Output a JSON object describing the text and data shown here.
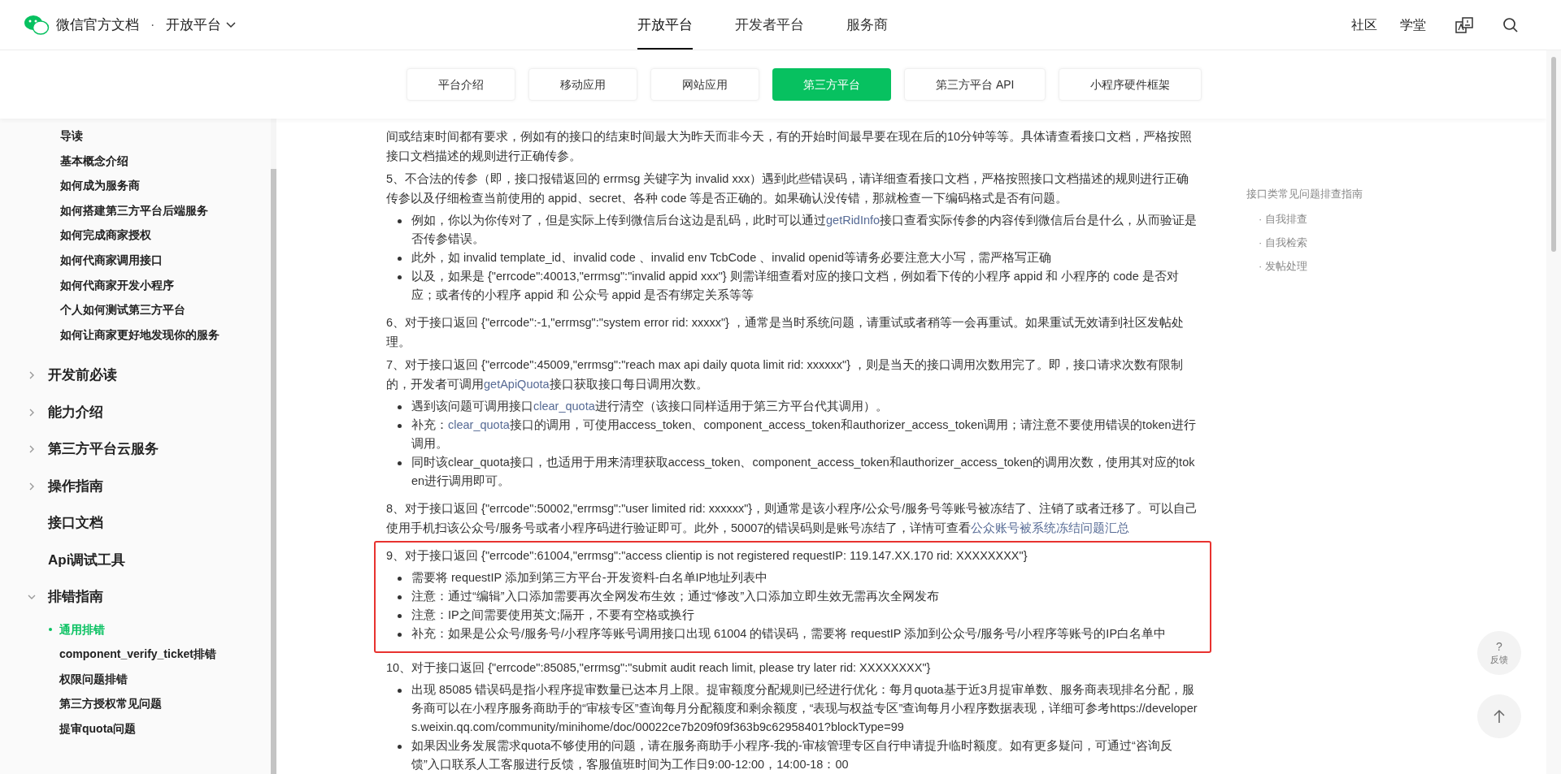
{
  "header": {
    "brand": "微信官方文档",
    "separator": "·",
    "platform": "开放平台",
    "nav": [
      {
        "label": "开放平台",
        "selected": true
      },
      {
        "label": "开发者平台",
        "selected": false
      },
      {
        "label": "服务商",
        "selected": false
      }
    ],
    "links": [
      "社区",
      "学堂"
    ]
  },
  "subnav": [
    {
      "label": "平台介绍",
      "selected": false
    },
    {
      "label": "移动应用",
      "selected": false
    },
    {
      "label": "网站应用",
      "selected": false
    },
    {
      "label": "第三方平台",
      "selected": true
    },
    {
      "label": "第三方平台 API",
      "selected": false
    },
    {
      "label": "小程序硬件框架",
      "selected": false
    }
  ],
  "sidebar": {
    "links": [
      {
        "label": "导读",
        "selected": false
      },
      {
        "label": "基本概念介绍",
        "selected": false
      },
      {
        "label": "如何成为服务商",
        "selected": false
      },
      {
        "label": "如何搭建第三方平台后端服务",
        "selected": false
      },
      {
        "label": "如何完成商家授权",
        "selected": false
      },
      {
        "label": "如何代商家调用接口",
        "selected": false
      },
      {
        "label": "如何代商家开发小程序",
        "selected": false
      },
      {
        "label": "个人如何测试第三方平台",
        "selected": false
      },
      {
        "label": "如何让商家更好地发现你的服务",
        "selected": false
      }
    ],
    "sections": [
      {
        "label": "开发前必读",
        "kind": "group",
        "expanded": false
      },
      {
        "label": "能力介绍",
        "kind": "group",
        "expanded": false
      },
      {
        "label": "第三方平台云服务",
        "kind": "group",
        "expanded": false
      },
      {
        "label": "操作指南",
        "kind": "group",
        "expanded": false
      },
      {
        "label": "接口文档",
        "kind": "link"
      },
      {
        "label": "Api调试工具",
        "kind": "link"
      },
      {
        "label": "排错指南",
        "kind": "group",
        "expanded": true,
        "children": [
          {
            "label": "通用排错",
            "selected": true
          },
          {
            "label": "component_verify_ticket排错",
            "selected": false
          },
          {
            "label": "权限问题排错",
            "selected": false
          },
          {
            "label": "第三方授权常见问题",
            "selected": false
          },
          {
            "label": "提审quota问题",
            "selected": false
          }
        ]
      }
    ]
  },
  "content": [
    {
      "kind": "paragraph",
      "parts": [
        {
          "kind": "text",
          "text": "间或结束时间都有要求，例如有的接口的结束时间最大为昨天而非今天，有的开始时间最早要在现在后的10分钟等等。具体请查看接口文档，严格按照接口文档描述的规则进行正确传参。"
        }
      ]
    },
    {
      "kind": "paragraph",
      "parts": [
        {
          "kind": "text",
          "text": "5、不合法的传参（即，接口报错返回的 errmsg 关键字为 invalid xxx）遇到此些错误码，请详细查看接口文档，严格按照接口文档描述的规则进行正确传参以及仔细检查当前使用的 appid、secret、各种 code 等是否正确的。如果确认没传错，那就检查一下编码格式是否有问题。"
        }
      ]
    },
    {
      "kind": "list",
      "items": [
        [
          {
            "kind": "text",
            "text": "例如，你以为你传对了，但是实际上传到微信后台这边是乱码，此时可以通过"
          },
          {
            "kind": "link",
            "text": "getRidInfo"
          },
          {
            "kind": "text",
            "text": "接口查看实际传参的内容传到微信后台是什么，从而验证是否传参错误。"
          }
        ],
        [
          {
            "kind": "text",
            "text": "此外，如 invalid template_id、invalid code 、invalid env TcbCode 、invalid openid等请务必要注意大小写，需严格写正确"
          }
        ],
        [
          {
            "kind": "text",
            "text": "以及，如果是 {\"errcode\":40013,\"errmsg\":\"invalid appid xxx\"} 则需详细查看对应的接口文档，例如看下传的小程序 appid 和 小程序的 code 是否对应；或者传的小程序 appid 和 公众号 appid 是否有绑定关系等等"
          }
        ]
      ]
    },
    {
      "kind": "paragraph",
      "parts": [
        {
          "kind": "text",
          "text": "6、对于接口返回 {\"errcode\":-1,\"errmsg\":\"system error rid: xxxxx\"} ，通常是当时系统问题，请重试或者稍等一会再重试。如果重试无效请到社区发帖处理。"
        }
      ]
    },
    {
      "kind": "paragraph",
      "parts": [
        {
          "kind": "text",
          "text": "7、对于接口返回 {\"errcode\":45009,\"errmsg\":\"reach max api daily quota limit rid: xxxxxx\"} ，则是当天的接口调用次数用完了。即，接口请求次数有限制的，开发者可调用"
        },
        {
          "kind": "link",
          "text": "getApiQuota"
        },
        {
          "kind": "text",
          "text": "接口获取接口每日调用次数。"
        }
      ]
    },
    {
      "kind": "list",
      "items": [
        [
          {
            "kind": "text",
            "text": "遇到该问题可调用接口"
          },
          {
            "kind": "link",
            "text": "clear_quota"
          },
          {
            "kind": "text",
            "text": "进行清空（该接口同样适用于第三方平台代其调用）。"
          }
        ],
        [
          {
            "kind": "text",
            "text": "补充："
          },
          {
            "kind": "link",
            "text": "clear_quota"
          },
          {
            "kind": "text",
            "text": "接口的调用，可使用access_token、component_access_token和authorizer_access_token调用；请注意不要使用错误的token进行调用。"
          }
        ],
        [
          {
            "kind": "text",
            "text": "同时该clear_quota接口，也适用于用来清理获取access_token、component_access_token和authorizer_access_token的调用次数，使用其对应的token进行调用即可。"
          }
        ]
      ]
    },
    {
      "kind": "paragraph",
      "parts": [
        {
          "kind": "text",
          "text": "8、对于接口返回 {\"errcode\":50002,\"errmsg\":\"user limited rid: xxxxxx\"}，则通常是该小程序/公众号/服务号等账号被冻结了、注销了或者迁移了。可以自己使用手机扫该公众号/服务号或者小程序码进行验证即可。此外，50007的错误码则是账号冻结了，详情可查看"
        },
        {
          "kind": "link",
          "text": "公众账号被系统冻结问题汇总"
        }
      ]
    },
    {
      "kind": "boxed",
      "blocks": [
        {
          "kind": "paragraph",
          "parts": [
            {
              "kind": "text",
              "text": "9、对于接口返回 {\"errcode\":61004,\"errmsg\":\"access clientip is not registered requestIP: 119.147.XX.170 rid: XXXXXXXX\"}"
            }
          ]
        },
        {
          "kind": "list",
          "items": [
            [
              {
                "kind": "text",
                "text": "需要将 requestIP 添加到第三方平台-开发资料-白名单IP地址列表中"
              }
            ],
            [
              {
                "kind": "text",
                "text": "注意：通过“编辑”入口添加需要再次全网发布生效；通过“修改”入口添加立即生效无需再次全网发布"
              }
            ],
            [
              {
                "kind": "text",
                "text": "注意：IP之间需要使用英文;隔开，不要有空格或换行"
              }
            ],
            [
              {
                "kind": "text",
                "text": "补充：如果是公众号/服务号/小程序等账号调用接口出现 61004 的错误码，需要将 requestIP 添加到公众号/服务号/小程序等账号的IP白名单中"
              }
            ]
          ]
        }
      ]
    },
    {
      "kind": "paragraph",
      "parts": [
        {
          "kind": "text",
          "text": "10、对于接口返回 {\"errcode\":85085,\"errmsg\":\"submit audit reach limit, please try later rid: XXXXXXXX\"}"
        }
      ]
    },
    {
      "kind": "list",
      "items": [
        [
          {
            "kind": "text",
            "text": "出现 85085 错误码是指小程序提审数量已达本月上限。提审额度分配规则已经进行优化：每月quota基于近3月提审单数、服务商表现排名分配，服务商可以在小程序服务商助手的“审核专区”查询每月分配额度和剩余额度，“表现与权益专区”查询每月小程序数据表现，详细可参考https://developers.weixin.qq.com/community/minihome/doc/00022ce7b209f09f363b9c62958401?blockType=99"
          }
        ],
        [
          {
            "kind": "text",
            "text": "如果因业务发展需求quota不够使用的问题，请在服务商助手小程序-我的-审核管理专区自行申请提升临时额度。如有更多疑问，可通过“咨询反馈”入口联系人工客服进行反馈，客服值班时间为工作日9:00-12:00，14:00-18：00"
          }
        ]
      ]
    }
  ],
  "toc": {
    "title": "接口类常见问题排查指南",
    "items": [
      "· 自我排查",
      "· 自我检索",
      "· 发帖处理"
    ]
  },
  "feedback": {
    "mark": "?",
    "label": "反馈"
  }
}
